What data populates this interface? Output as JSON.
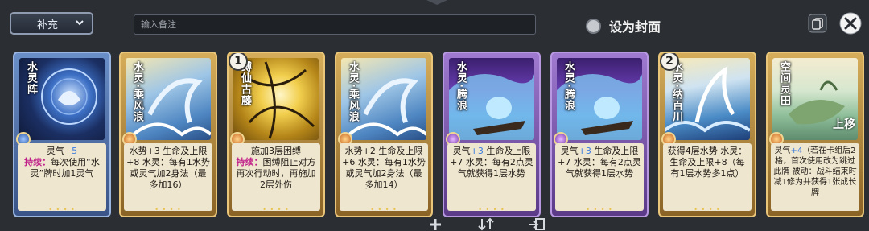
{
  "toolbar": {
    "dropdown_value": "补充",
    "note_placeholder": "输入备注",
    "cover_label": "设为封面"
  },
  "cards": [
    {
      "name": "水灵阵",
      "badge": "",
      "cost_type": "blue",
      "frame": "blue",
      "line1": "灵气+5",
      "line1_value": "+5",
      "body": [
        {
          "k": "持续："
        },
        {
          "t": "每次使用“水灵”牌时加1灵气"
        }
      ]
    },
    {
      "name": "水灵·乘风浪",
      "badge": "",
      "cost_type": "orange",
      "frame": "gold",
      "body": [
        {
          "t": "水势+3 生命及上限+8 水灵：每有1水势或灵气加2身法（最多加16）"
        }
      ]
    },
    {
      "name": "缚仙古藤",
      "badge": "1",
      "cost_type": "orange",
      "frame": "gold",
      "body": [
        {
          "t": "施加3层困缚 "
        },
        {
          "k": "持续："
        },
        {
          "t": "困缚阻止对方再次行动时，再施加2层外伤"
        }
      ]
    },
    {
      "name": "水灵·乘风浪",
      "badge": "",
      "cost_type": "orange",
      "frame": "gold",
      "body": [
        {
          "t": "水势+2 生命及上限+6 水灵：每有1水势或灵气加2身法（最多加14）"
        }
      ]
    },
    {
      "name": "水灵·腾浪",
      "badge": "",
      "cost_type": "purple",
      "frame": "purple",
      "body": [
        {
          "t": "灵气"
        },
        {
          "n": "+3"
        },
        {
          "t": " 生命及上限+7 水灵：每有2点灵气就获得1层水势"
        }
      ]
    },
    {
      "name": "水灵·腾浪",
      "badge": "",
      "cost_type": "purple",
      "frame": "purple",
      "body": [
        {
          "t": "灵气"
        },
        {
          "n": "+3"
        },
        {
          "t": " 生命及上限+7 水灵：每有2点灵气就获得1层水势"
        }
      ]
    },
    {
      "name": "水灵·纳百川",
      "badge": "2",
      "cost_type": "orange",
      "frame": "gold",
      "body": [
        {
          "t": "获得4层水势 水灵：生命及上限+8（每有1层水势多1点）"
        }
      ]
    },
    {
      "name": "空间灵田",
      "badge": "",
      "cost_type": "orange",
      "frame": "gold",
      "body": [
        {
          "t": "灵气"
        },
        {
          "n": "+4"
        },
        {
          "t": "（若在卡组后2格，首次使用改为跳过此牌 被动：战斗结束时减1修为并获得1张成长牌"
        }
      ]
    }
  ],
  "overlay": {
    "up_move": "上移"
  },
  "icons": [
    "chevron-down-icon",
    "copy-icon",
    "close-icon",
    "plus-icon",
    "sort-icon",
    "move-icon",
    "radio-icon"
  ],
  "colors": {
    "keyword": "#c0208a",
    "number": "#3a7be0",
    "desc_bg": "#efe6cf"
  }
}
